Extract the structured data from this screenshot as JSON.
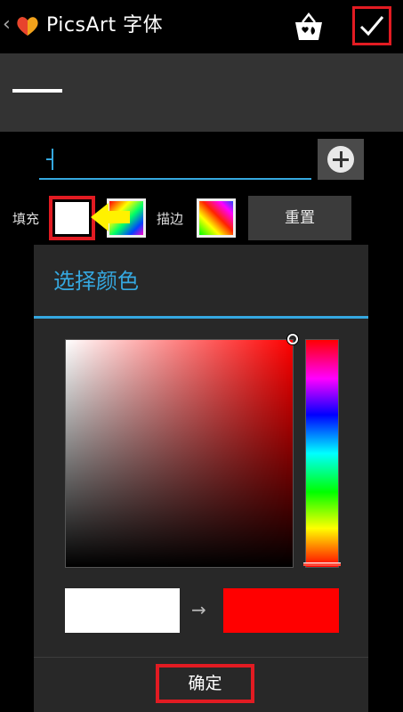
{
  "header": {
    "title": "PicsArt 字体",
    "back_icon": "chevron-left-icon",
    "shop_icon": "shopping-basket-icon",
    "confirm_icon": "checkmark-icon"
  },
  "toolbar": {
    "fill_label": "填充",
    "stroke_label": "描边",
    "reset_label": "重置",
    "add_icon": "plus-icon"
  },
  "dialog": {
    "title": "选择颜色",
    "arrow": "→",
    "ok_label": "确定",
    "old_color": "#ffffff",
    "new_color": "#ff0000"
  },
  "colors": {
    "accent": "#35a8e0",
    "highlight": "#e21b22"
  }
}
